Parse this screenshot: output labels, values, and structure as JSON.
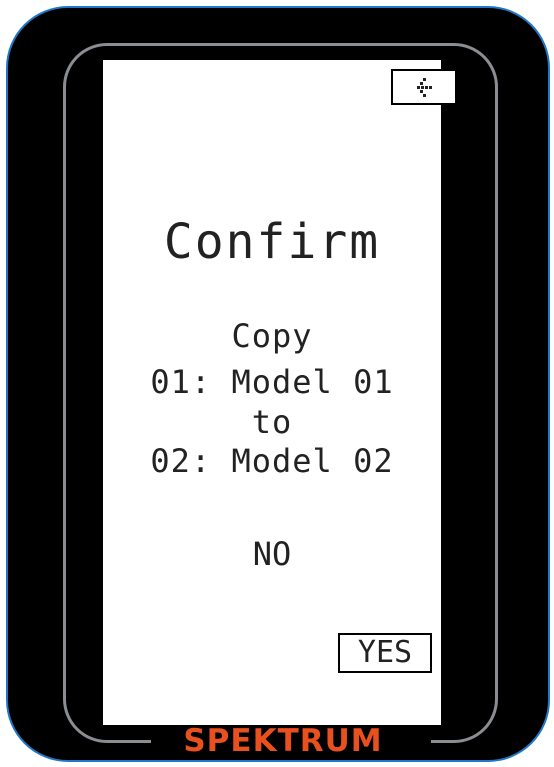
{
  "brand": {
    "name": "SPEKTRUM",
    "color": "#e8501e"
  },
  "header": {
    "back_icon": "back-arrow-icon"
  },
  "dialog": {
    "title": "Confirm",
    "message": {
      "action": "Copy",
      "source": "01: Model 01",
      "connector": "to",
      "destination": "02: Model 02"
    },
    "options": {
      "no_label": "NO",
      "yes_label": "YES",
      "selected": "YES"
    }
  }
}
